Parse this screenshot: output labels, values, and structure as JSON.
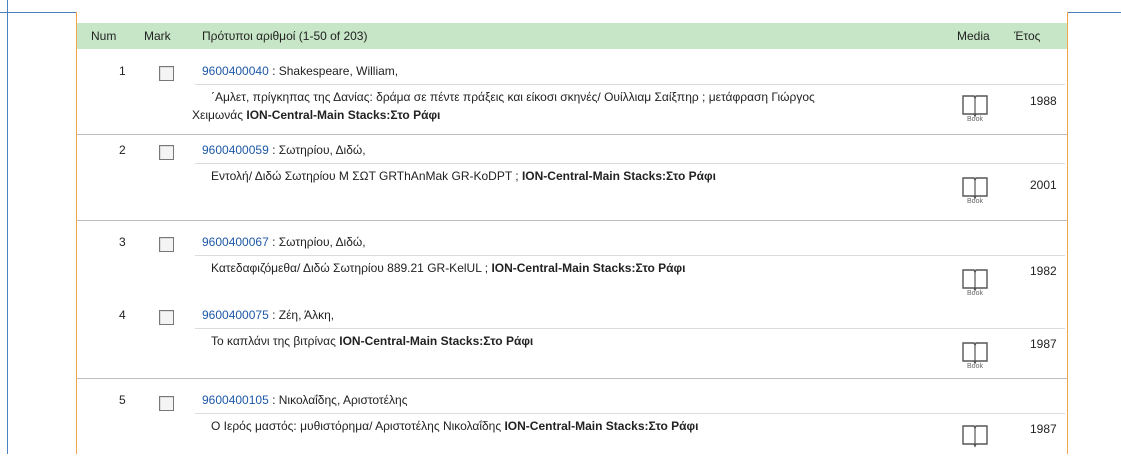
{
  "header": {
    "num": "Num",
    "mark": "Mark",
    "title": "Πρότυποι αριθμοί (1-50 of 203)",
    "media": "Media",
    "year": "Έτος"
  },
  "location": "ION-Central-Main Stacks:Στο Ράφι",
  "book_label": "Book",
  "records": [
    {
      "num": "1",
      "callno": "9600400040",
      "author": " : Shakespeare, William,",
      "desc_a": "΄Αμλετ, πρίγκηπας της Δανίας: δράμα σε πέντε πράξεις και είκοσι σκηνές/ Ουίλλιαμ Σαίξπηρ ; μετάφραση Γιώργος",
      "desc_b": "Χειμωνάς ",
      "year": "1988"
    },
    {
      "num": "2",
      "callno": "9600400059",
      "author": " : Σωτηρίου, Διδώ,",
      "desc_a": "Εντολή/ Διδώ Σωτηρίου M ΣΩΤ GRThAnMak GR-KoDPT ; ",
      "year": "2001"
    },
    {
      "num": "3",
      "callno": "9600400067",
      "author": " : Σωτηρίου, Διδώ,",
      "desc_a": "Κατεδαφιζόμεθα/ Διδώ Σωτηρίου 889.21 GR-KelUL ; ",
      "year": "1982"
    },
    {
      "num": "4",
      "callno": "9600400075",
      "author": " : Ζέη, Άλκη,",
      "desc_a": "Το καπλάνι της βιτρίνας ",
      "year": "1987"
    },
    {
      "num": "5",
      "callno": "9600400105",
      "author": " : Νικολαΐδης, Αριστοτέλης",
      "desc_a": "Ο Ιερός μαστός: μυθιστόρημα/ Αριστοτέλης Νικολαΐδης ",
      "year": "1987"
    }
  ]
}
